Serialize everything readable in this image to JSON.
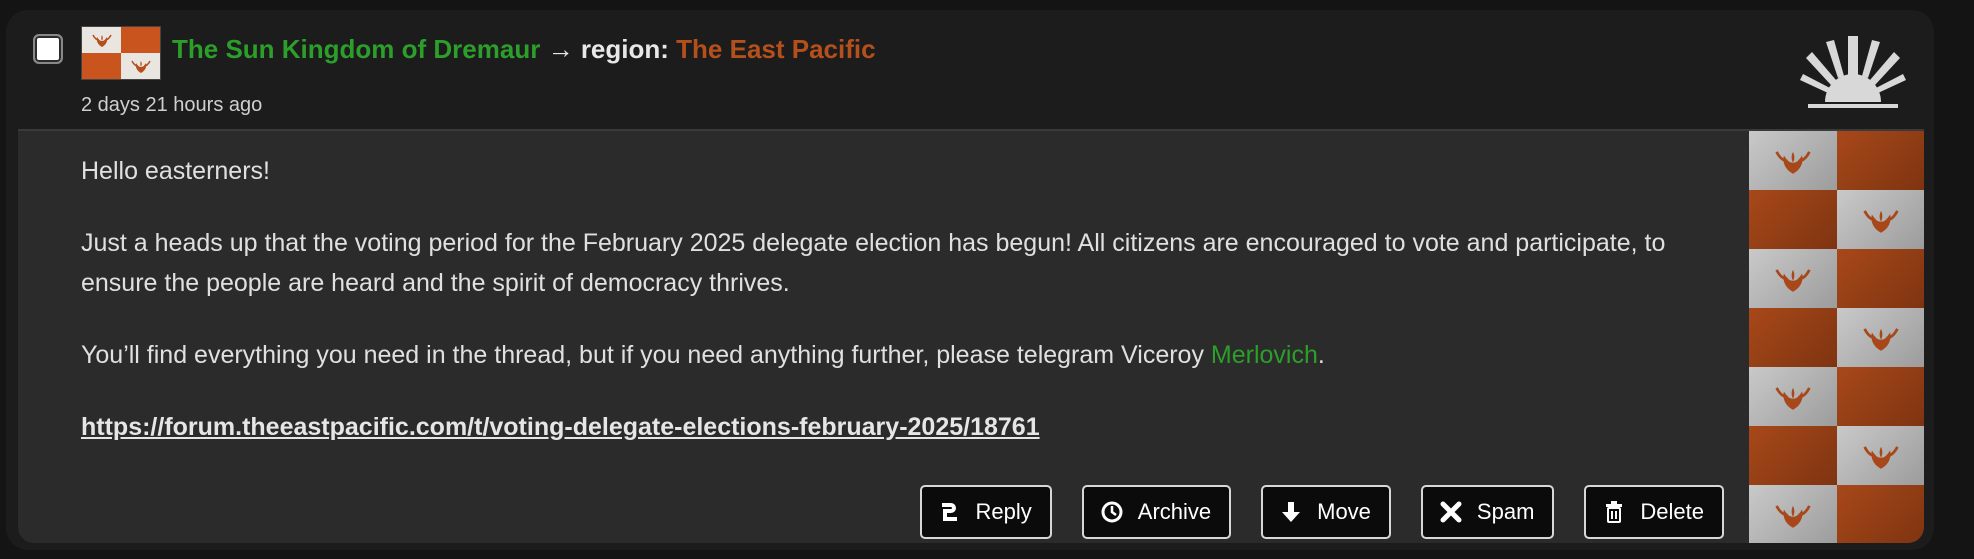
{
  "post": {
    "nation_name": "The Sun Kingdom of Dremaur",
    "arrow": "→",
    "region_label": "region:",
    "region_name": "The East Pacific",
    "timestamp": "2 days 21 hours ago",
    "paragraphs": {
      "greeting": "Hello easterners!",
      "announcement": "Just a heads up that the voting period for the February 2025 delegate election has begun! All citizens are encouraged to vote and participate, to ensure the people are heard and the spirit of democracy thrives.",
      "contact_prefix": "You’ll find everything you need in the thread, but if you need anything further, please telegram Viceroy ",
      "contact_link": "Merlovich",
      "contact_suffix": ".",
      "thread_url": "https://forum.theeastpacific.com/t/voting-delegate-elections-february-2025/18761"
    }
  },
  "actions": {
    "reply": "Reply",
    "archive": "Archive",
    "move": "Move",
    "spam": "Spam",
    "delete": "Delete"
  },
  "colors": {
    "nation_link": "#2c9e2a",
    "region_link": "#b5501c",
    "flag_orange": "#c9541d",
    "flag_white": "#e9e6e2",
    "card_bg": "#1c1c1c",
    "body_bg": "#2b2b2b"
  },
  "icons": {
    "region_logo": "rising-sun-icon",
    "flag_emblem": "phoenix-icon",
    "reply": "reply-icon",
    "archive": "clock-icon",
    "move": "arrow-down-icon",
    "spam": "x-icon",
    "delete": "trash-icon"
  }
}
